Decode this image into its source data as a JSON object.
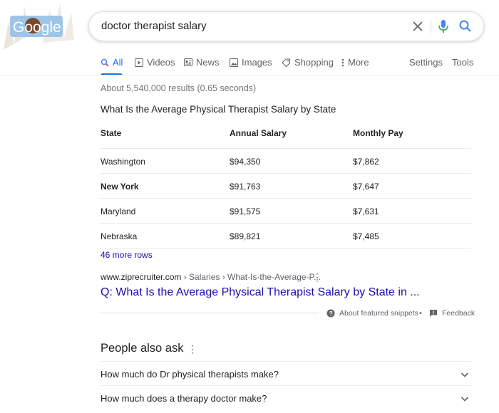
{
  "logo": {
    "text": "Google"
  },
  "search": {
    "query": "doctor therapist salary"
  },
  "tabs": {
    "all": "All",
    "videos": "Videos",
    "news": "News",
    "images": "Images",
    "shopping": "Shopping",
    "more": "More",
    "settings": "Settings",
    "tools": "Tools"
  },
  "stats": "About 5,540,000 results (0.65 seconds)",
  "snippet": {
    "title": "What Is the Average Physical Therapist Salary by State",
    "headers": [
      "State",
      "Annual Salary",
      "Monthly Pay"
    ],
    "rows": [
      [
        "Washington",
        "$94,350",
        "$7,862"
      ],
      [
        "New York",
        "$91,763",
        "$7,647"
      ],
      [
        "Maryland",
        "$91,575",
        "$7,631"
      ],
      [
        "Nebraska",
        "$89,821",
        "$7,485"
      ]
    ],
    "more_rows": "46 more rows",
    "cite_domain": "www.ziprecruiter.com",
    "cite_path": " › Salaries › What-Is-the-Average-P...",
    "link": "Q: What Is the Average Physical Therapist Salary by State in ...",
    "about": "About featured snippets",
    "separator": "•",
    "feedback": "Feedback"
  },
  "paa": {
    "title": "People also ask",
    "questions": [
      "How much do Dr physical therapists make?",
      "How much does a therapy doctor make?"
    ]
  },
  "colors": {
    "accent": "#1a73e8",
    "link": "#1a0dab",
    "muted": "#5f6368"
  }
}
